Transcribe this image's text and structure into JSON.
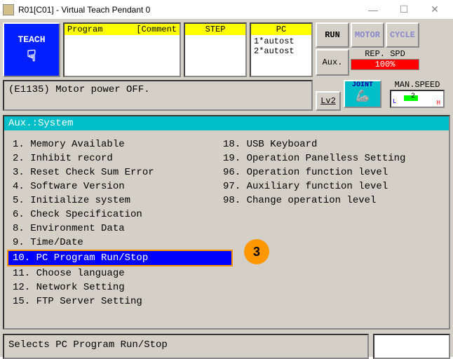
{
  "titlebar": {
    "text": "R01[C01] - Virtual Teach Pendant 0"
  },
  "teach": {
    "label": "TEACH"
  },
  "panels": {
    "program": {
      "hdr_left": "Program",
      "hdr_right": "[Comment"
    },
    "step": {
      "hdr": "STEP"
    },
    "pc": {
      "hdr": "PC",
      "line1": "1*autost",
      "line2": "2*autost"
    }
  },
  "buttons": {
    "run": "RUN",
    "motor": "MOTOR",
    "cycle": "CYCLE",
    "aux": "Aux.",
    "lv": "Lv2",
    "joint": "JOINT"
  },
  "speed": {
    "rep_label": "REP. SPD",
    "rep_value": "100%",
    "man_label": "MAN.SPEED",
    "man_num": "2"
  },
  "status": {
    "msg": "(E1135) Motor power OFF."
  },
  "content": {
    "header": "Aux.:System"
  },
  "menu_left": [
    {
      "n": "1.",
      "t": "Memory Available"
    },
    {
      "n": "2.",
      "t": "Inhibit record"
    },
    {
      "n": "3.",
      "t": "Reset Check Sum Error"
    },
    {
      "n": "4.",
      "t": "Software Version"
    },
    {
      "n": "5.",
      "t": "Initialize system"
    },
    {
      "n": "6.",
      "t": "Check Specification"
    },
    {
      "n": "8.",
      "t": "Environment Data"
    },
    {
      "n": "9.",
      "t": "Time/Date"
    },
    {
      "n": "10.",
      "t": "PC Program Run/Stop",
      "sel": true
    },
    {
      "n": "11.",
      "t": "Choose language"
    },
    {
      "n": "12.",
      "t": "Network Setting"
    },
    {
      "n": "15.",
      "t": "FTP Server Setting"
    }
  ],
  "menu_right": [
    {
      "n": "18.",
      "t": "USB Keyboard"
    },
    {
      "n": "19.",
      "t": "Operation Panelless Setting"
    },
    {
      "n": "96.",
      "t": "Operation function level"
    },
    {
      "n": "97.",
      "t": "Auxiliary function level"
    },
    {
      "n": "98.",
      "t": "Change operation level"
    }
  ],
  "callout": "3",
  "bottom": {
    "msg": "Selects PC Program Run/Stop"
  }
}
